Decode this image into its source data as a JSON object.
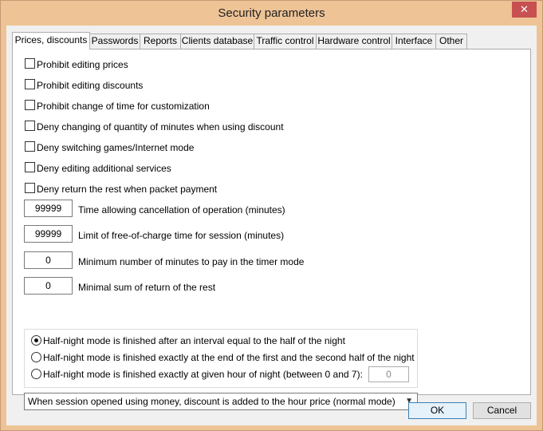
{
  "window": {
    "title": "Security parameters",
    "close_glyph": "✕"
  },
  "tabs": [
    {
      "label": "Prices, discounts",
      "active": true
    },
    {
      "label": "Passwords",
      "active": false
    },
    {
      "label": "Reports",
      "active": false
    },
    {
      "label": "Clients database",
      "active": false
    },
    {
      "label": "Traffic control",
      "active": false
    },
    {
      "label": "Hardware control",
      "active": false
    },
    {
      "label": "Interface",
      "active": false
    },
    {
      "label": "Other",
      "active": false
    }
  ],
  "checkboxes": [
    {
      "label": "Prohibit editing prices",
      "checked": false
    },
    {
      "label": "Prohibit editing discounts",
      "checked": false
    },
    {
      "label": "Prohibit change of time for customization",
      "checked": false
    },
    {
      "label": "Deny changing of quantity of minutes when using discount",
      "checked": false
    },
    {
      "label": "Deny switching games/Internet mode",
      "checked": false
    },
    {
      "label": "Deny editing additional services",
      "checked": false
    },
    {
      "label": "Deny return the rest when packet payment",
      "checked": false
    }
  ],
  "numeric_fields": [
    {
      "value": "99999",
      "label": "Time allowing cancellation of operation (minutes)"
    },
    {
      "value": "99999",
      "label": "Limit of free-of-charge time for session (minutes)"
    },
    {
      "value": "0",
      "label": "Minimum number of minutes to pay in the timer mode"
    },
    {
      "value": "0",
      "label": "Minimal sum of return of the rest"
    }
  ],
  "half_night": {
    "options": [
      {
        "label": "Half-night mode is finished after an interval equal to the half of the night",
        "checked": true
      },
      {
        "label": "Half-night mode is finished exactly at the end of the first and the second half of the night",
        "checked": false
      },
      {
        "label": "Half-night mode is finished exactly at given hour of night (between 0 and 7):",
        "checked": false
      }
    ],
    "hour_value": "0"
  },
  "discount_mode": {
    "selected": "When session opened using money, discount is added to the hour price (normal mode)"
  },
  "buttons": {
    "ok": "OK",
    "cancel": "Cancel"
  }
}
